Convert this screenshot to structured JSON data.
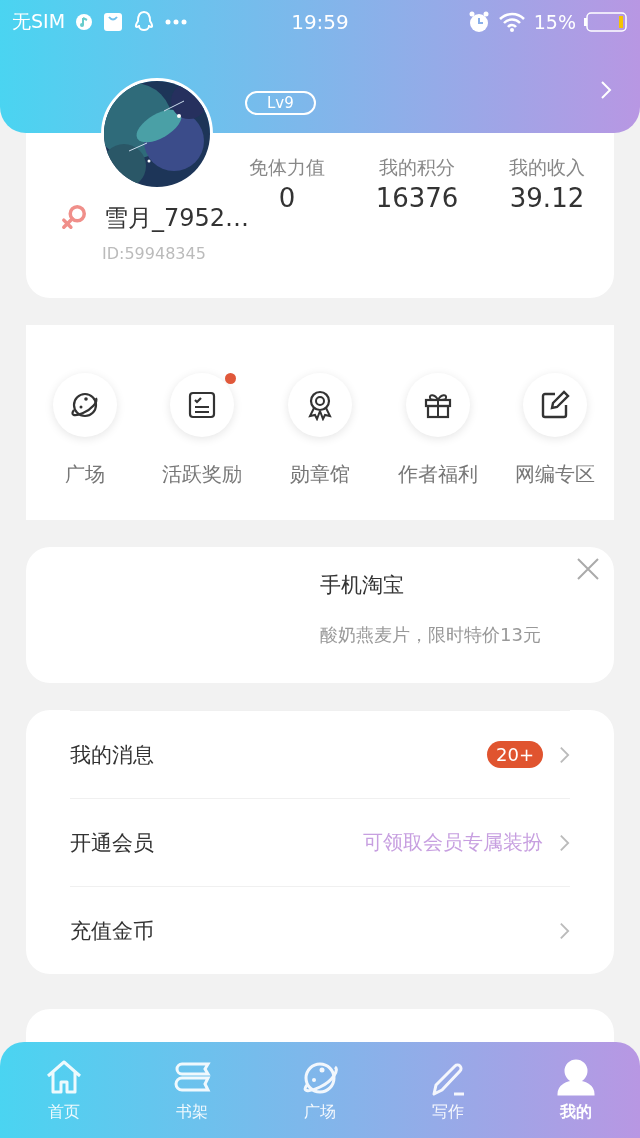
{
  "status_bar": {
    "carrier": "无SIM",
    "time": "19:59",
    "battery": "15%"
  },
  "profile": {
    "level_badge": "Lv9",
    "female": true,
    "username": "雪月_7952…",
    "user_id": "ID:59948345",
    "stats": [
      {
        "label": "免体力值",
        "value": "0"
      },
      {
        "label": "我的积分",
        "value": "16376"
      },
      {
        "label": "我的收入",
        "value": "39.12"
      }
    ]
  },
  "shortcuts": [
    {
      "label": "广场",
      "notification_dot": false
    },
    {
      "label": "活跃奖励",
      "notification_dot": true
    },
    {
      "label": "勋章馆",
      "notification_dot": false
    },
    {
      "label": "作者福利",
      "notification_dot": false
    },
    {
      "label": "网编专区",
      "notification_dot": false
    }
  ],
  "ad": {
    "title": "手机淘宝",
    "subtitle": "酸奶燕麦片，限时特价13元"
  },
  "menu": [
    {
      "label": "我的消息",
      "badge": "20+"
    },
    {
      "label": "开通会员",
      "hint": "可领取会员专属装扮"
    },
    {
      "label": "充值金币"
    }
  ],
  "tab_bar": [
    {
      "label": "首页",
      "selected": false
    },
    {
      "label": "书架",
      "selected": false
    },
    {
      "label": "广场",
      "selected": false
    },
    {
      "label": "写作",
      "selected": false
    },
    {
      "label": "我的",
      "selected": true
    }
  ]
}
